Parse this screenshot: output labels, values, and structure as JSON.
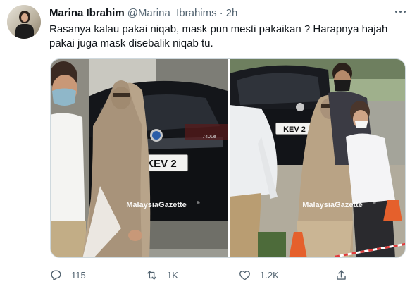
{
  "tweet": {
    "author_name": "Marina Ibrahim",
    "handle": "@Marina_Ibrahims",
    "separator": "·",
    "time": "2h",
    "text": "Rasanya kalau pakai niqab, mask pun mesti pakaikan ? Harapnya hajah pakai juga mask disebalik niqab tu."
  },
  "media": {
    "photos": [
      {
        "watermark": "MalaysiaGazette",
        "watermark_mark": "®",
        "plate": "KEV 2",
        "badge": "740Le"
      },
      {
        "watermark": "MalaysiaGazette",
        "watermark_mark": "®",
        "plate": "KEV 2"
      }
    ]
  },
  "actions": {
    "replies": "115",
    "retweets": "1K",
    "likes": "1.2K"
  },
  "icons": {
    "more": "more-horizontal-icon",
    "reply": "reply-icon",
    "retweet": "retweet-icon",
    "like": "heart-icon",
    "share": "share-icon"
  },
  "colors": {
    "text": "#0f1419",
    "secondary": "#536471",
    "border": "#cfd9de"
  }
}
